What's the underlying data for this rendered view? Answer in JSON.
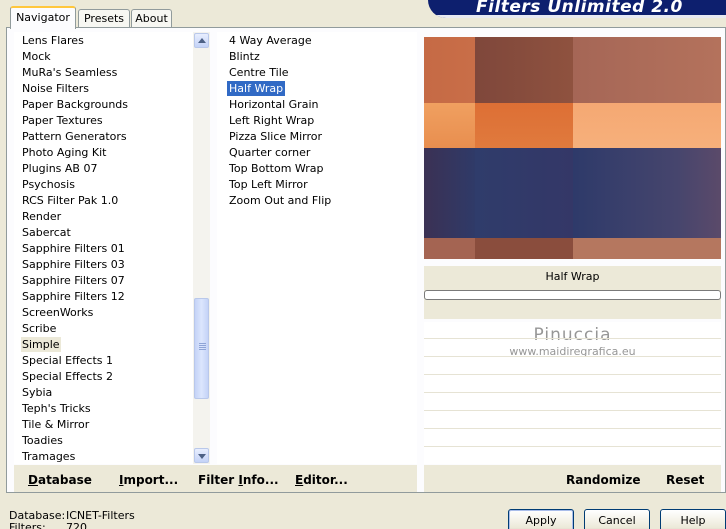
{
  "tabs": [
    {
      "label": "Navigator",
      "active": true
    },
    {
      "label": "Presets",
      "active": false
    },
    {
      "label": "About",
      "active": false
    }
  ],
  "banner": {
    "title": "Filters Unlimited 2.0"
  },
  "categories": [
    "Lens Flares",
    "Mock",
    "MuRa's Seamless",
    "Noise Filters",
    "Paper Backgrounds",
    "Paper Textures",
    "Pattern Generators",
    "Photo Aging Kit",
    "Plugins AB 07",
    "Psychosis",
    "RCS Filter Pak 1.0",
    "Render",
    "Sabercat",
    "Sapphire Filters 01",
    "Sapphire Filters 03",
    "Sapphire Filters 07",
    "Sapphire Filters 12",
    "ScreenWorks",
    "Scribe",
    "Simple",
    "Special Effects 1",
    "Special Effects 2",
    "Sybia",
    "Teph's Tricks",
    "Tile & Mirror",
    "Toadies",
    "Tramages"
  ],
  "selected_category": "Simple",
  "filters": [
    "4 Way Average",
    "Blintz",
    "Centre Tile",
    "Half Wrap",
    "Horizontal Grain",
    "Left Right Wrap",
    "Pizza Slice Mirror",
    "Quarter corner",
    "Top Bottom Wrap",
    "Top Left Mirror",
    "Zoom Out and Flip"
  ],
  "selected_filter": "Half Wrap",
  "preview": {
    "filter_name": "Half Wrap",
    "progress": 0
  },
  "watermark": {
    "name": "Pinuccia",
    "url": "www.maidiregrafica.eu"
  },
  "left_buttons": {
    "database": {
      "label": "Database",
      "u": "D",
      "rest": "atabase"
    },
    "import": {
      "label": "Import...",
      "u": "I",
      "rest": "mport..."
    },
    "filter_info": {
      "label": "Filter Info...",
      "pre": "Filter ",
      "u": "I",
      "rest": "nfo..."
    },
    "editor": {
      "label": "Editor...",
      "u": "E",
      "rest": "ditor..."
    }
  },
  "right_buttons": {
    "randomize": "Randomize",
    "reset": "Reset"
  },
  "status": {
    "database_label": "Database:",
    "database_value": "ICNET-Filters",
    "filters_label": "Filters:",
    "filters_value": "720"
  },
  "dialog_buttons": {
    "apply": "Apply",
    "cancel": "Cancel",
    "help": "Help"
  },
  "colors": {
    "selection": "#316ac5",
    "banner": "#0d1f6e",
    "preview_orange": "#e2773c",
    "preview_navy": "#2f3a68"
  }
}
